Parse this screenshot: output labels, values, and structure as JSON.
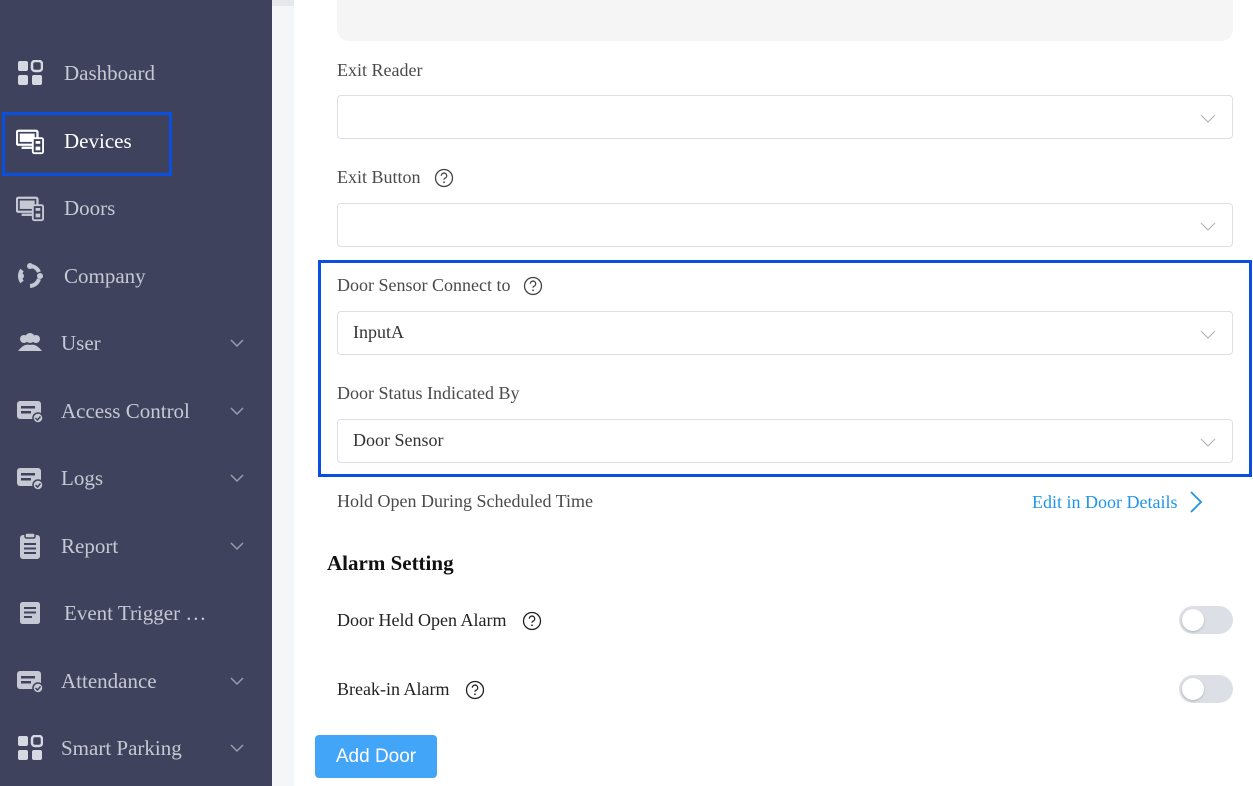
{
  "sidebar": {
    "items": [
      {
        "label": "Dashboard",
        "icon": "dashboard-grid-icon",
        "expandable": false,
        "active": false
      },
      {
        "label": "Devices",
        "icon": "devices-icon",
        "expandable": false,
        "active": true
      },
      {
        "label": "Doors",
        "icon": "doors-icon",
        "expandable": false,
        "active": false
      },
      {
        "label": "Company",
        "icon": "company-icon",
        "expandable": false,
        "active": false
      },
      {
        "label": "User",
        "icon": "user-group-icon",
        "expandable": true,
        "active": false
      },
      {
        "label": "Access Control",
        "icon": "access-control-icon",
        "expandable": true,
        "active": false
      },
      {
        "label": "Logs",
        "icon": "logs-icon",
        "expandable": true,
        "active": false
      },
      {
        "label": "Report",
        "icon": "report-icon",
        "expandable": true,
        "active": false
      },
      {
        "label": "Event Trigger …",
        "icon": "event-trigger-icon",
        "expandable": false,
        "active": false
      },
      {
        "label": "Attendance",
        "icon": "attendance-icon",
        "expandable": true,
        "active": false
      },
      {
        "label": "Smart Parking",
        "icon": "smart-parking-icon",
        "expandable": true,
        "active": false
      }
    ]
  },
  "form": {
    "exit_reader": {
      "label": "Exit Reader",
      "value": ""
    },
    "exit_button": {
      "label": "Exit Button",
      "value": ""
    },
    "door_sensor_connect": {
      "label": "Door Sensor Connect to",
      "value": "InputA"
    },
    "door_status": {
      "label": "Door Status Indicated By",
      "value": "Door Sensor"
    },
    "hold_open": {
      "label": "Hold Open During Scheduled Time",
      "link": "Edit in Door Details"
    }
  },
  "alarm": {
    "title": "Alarm Setting",
    "held_open": {
      "label": "Door Held Open Alarm",
      "enabled": false
    },
    "break_in": {
      "label": "Break-in Alarm",
      "enabled": false
    }
  },
  "actions": {
    "add_door": "Add Door"
  },
  "colors": {
    "sidebar_bg": "#3f425d",
    "accent": "#42a5f8",
    "link": "#1f95e8",
    "highlight": "#0b4fe0"
  }
}
